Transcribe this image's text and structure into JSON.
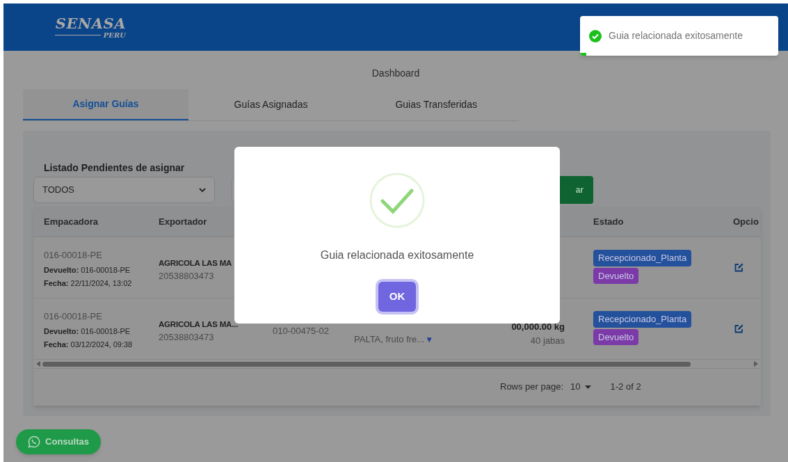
{
  "header": {
    "logo_title": "SENASA",
    "logo_subtitle": "PERU"
  },
  "page_title": "Dashboard",
  "tabs": [
    {
      "label": "Asignar Guías",
      "selected": true
    },
    {
      "label": "Guías Asignadas",
      "selected": false
    },
    {
      "label": "Guias Transferidas",
      "selected": false
    }
  ],
  "panel": {
    "title": "Listado Pendientes de asignar",
    "filter": {
      "value": "TODOS"
    },
    "action_button": "ar"
  },
  "table": {
    "columns": [
      {
        "label": "Empacadora"
      },
      {
        "label": "Exportador"
      },
      {
        "label": "Estado"
      },
      {
        "label": "Opcio"
      }
    ],
    "rows": [
      {
        "empacadora": {
          "code": "016-00018-PE",
          "devuelto": "**Devuelto:** 016-00018-PE",
          "fecha": "**Fecha:** 22/11/2024, 13:02"
        },
        "exportador": {
          "name": "AGRICOLA LAS MA",
          "ruc": "20538803473"
        },
        "estado": [
          {
            "label": "Recepcionado_Planta",
            "color": "#24519b"
          },
          {
            "label": "Devuelto",
            "color": "#7b3aa8"
          }
        ]
      },
      {
        "empacadora": {
          "code": "016-00018-PE",
          "devuelto": "**Devuelto:** 016-00018-PE",
          "fecha": "**Fecha:** 03/12/2024, 09:38"
        },
        "exportador": {
          "name": "AGRICOLA LAS MA...",
          "ruc": "20538803473"
        },
        "column_3": "010-00475-02",
        "column_4": {
          "text": "PALTA, fruto fre...",
          "expand": "▼"
        },
        "column_5": {
          "weight": "00,000.00 kg",
          "count": "40 jabas"
        },
        "estado": [
          {
            "label": "Recepcionado_Planta",
            "color": "#24519b"
          },
          {
            "label": "Devuelto",
            "color": "#7b3aa8"
          }
        ]
      }
    ],
    "footer": {
      "rows_per_page_label": "Rows per page:",
      "rows_per_page": "10",
      "range": "1-2 of 2"
    }
  },
  "consultas_button": "Consultas",
  "modal": {
    "message": "Guia relacionada exitosamente",
    "button": "OK"
  },
  "toast": {
    "message": "Guia relacionada exitosamente",
    "level": 0.03
  }
}
